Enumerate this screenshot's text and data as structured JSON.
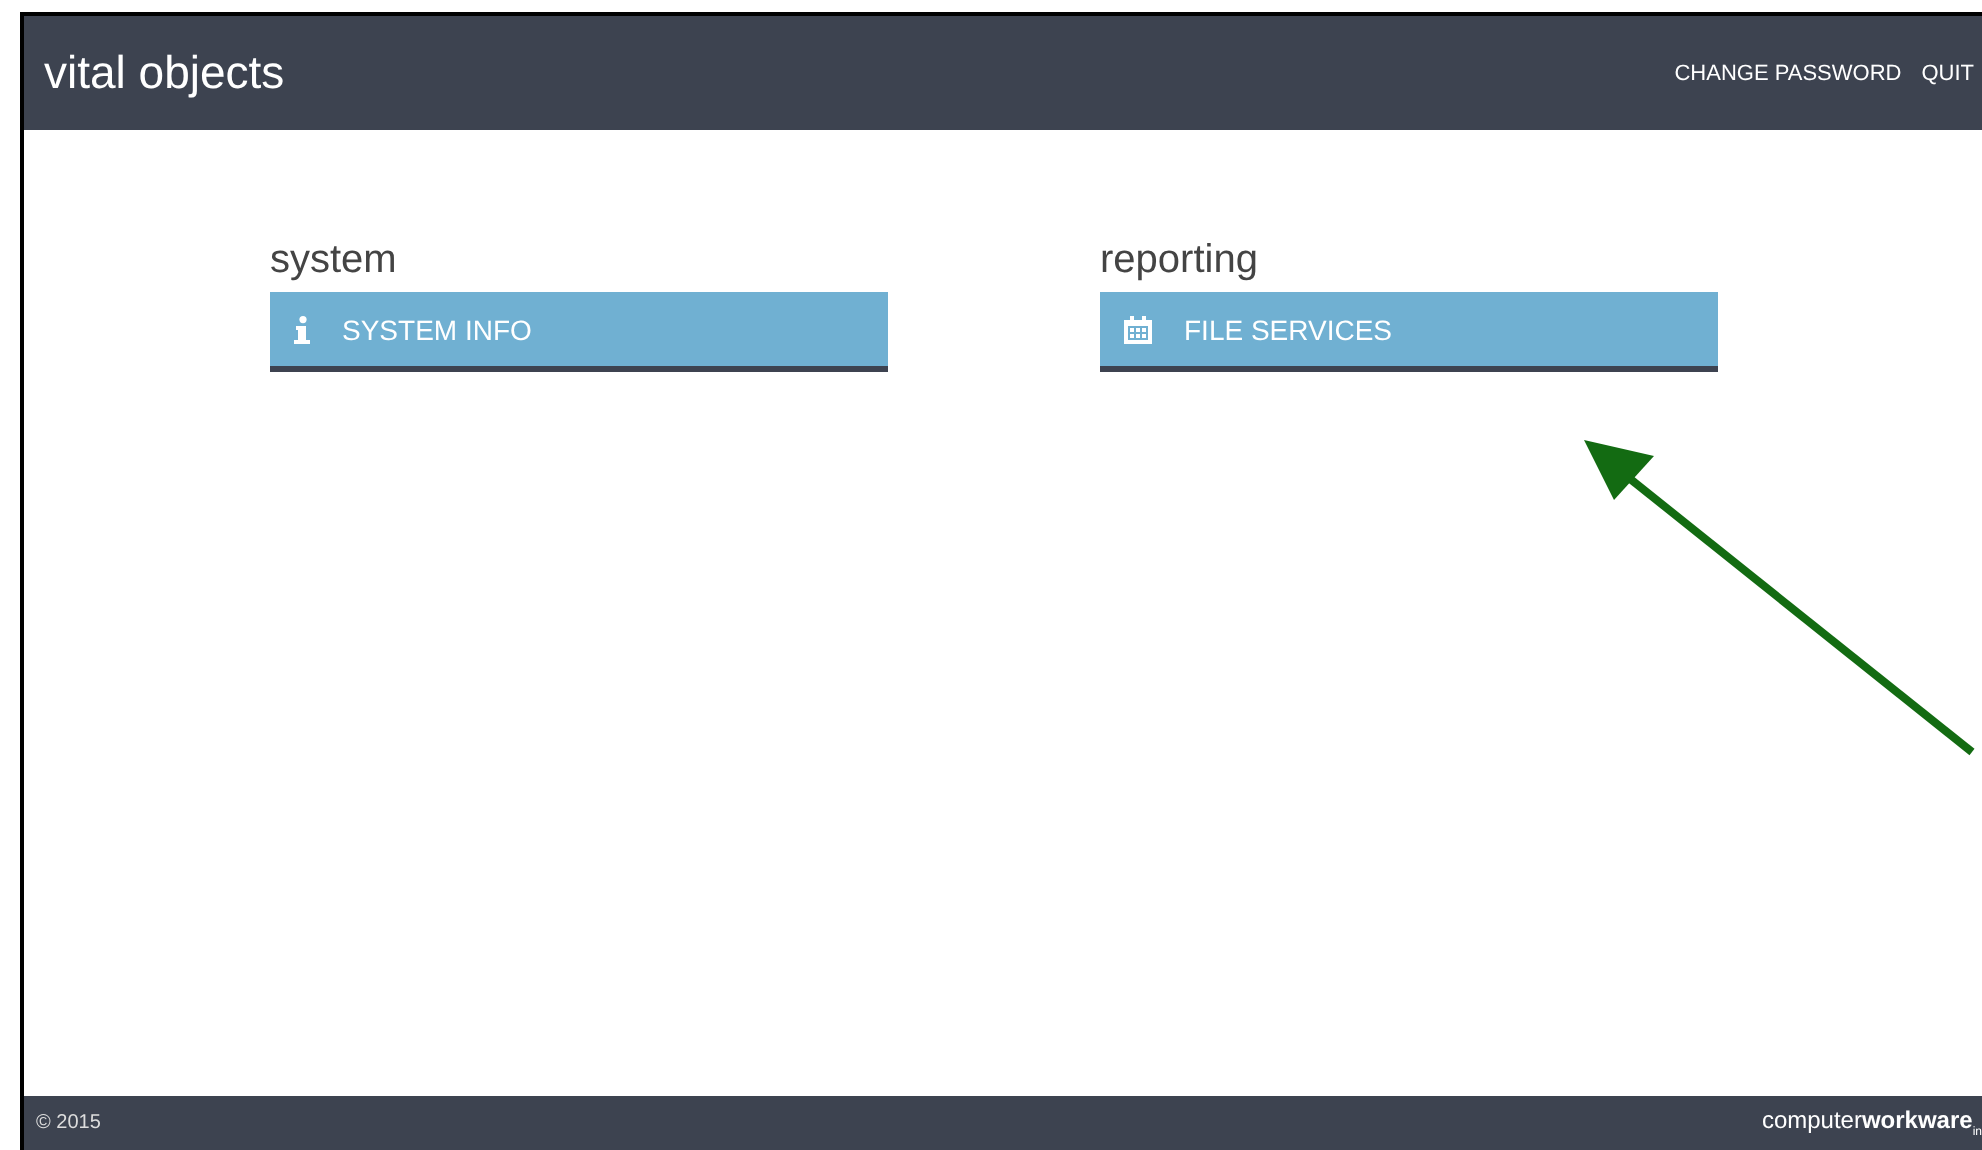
{
  "header": {
    "title": "vital objects",
    "links": [
      "CHANGE PASSWORD",
      "QUIT"
    ]
  },
  "sections": [
    {
      "title": "system",
      "tiles": [
        {
          "label": "SYSTEM INFO",
          "kind": "info"
        }
      ]
    },
    {
      "title": "reporting",
      "tiles": [
        {
          "label": "FILE SERVICES",
          "kind": "calendar"
        }
      ]
    }
  ],
  "footer": {
    "copyright": "© 2015",
    "brand": "computer**workware**$_{in}$"
  }
}
